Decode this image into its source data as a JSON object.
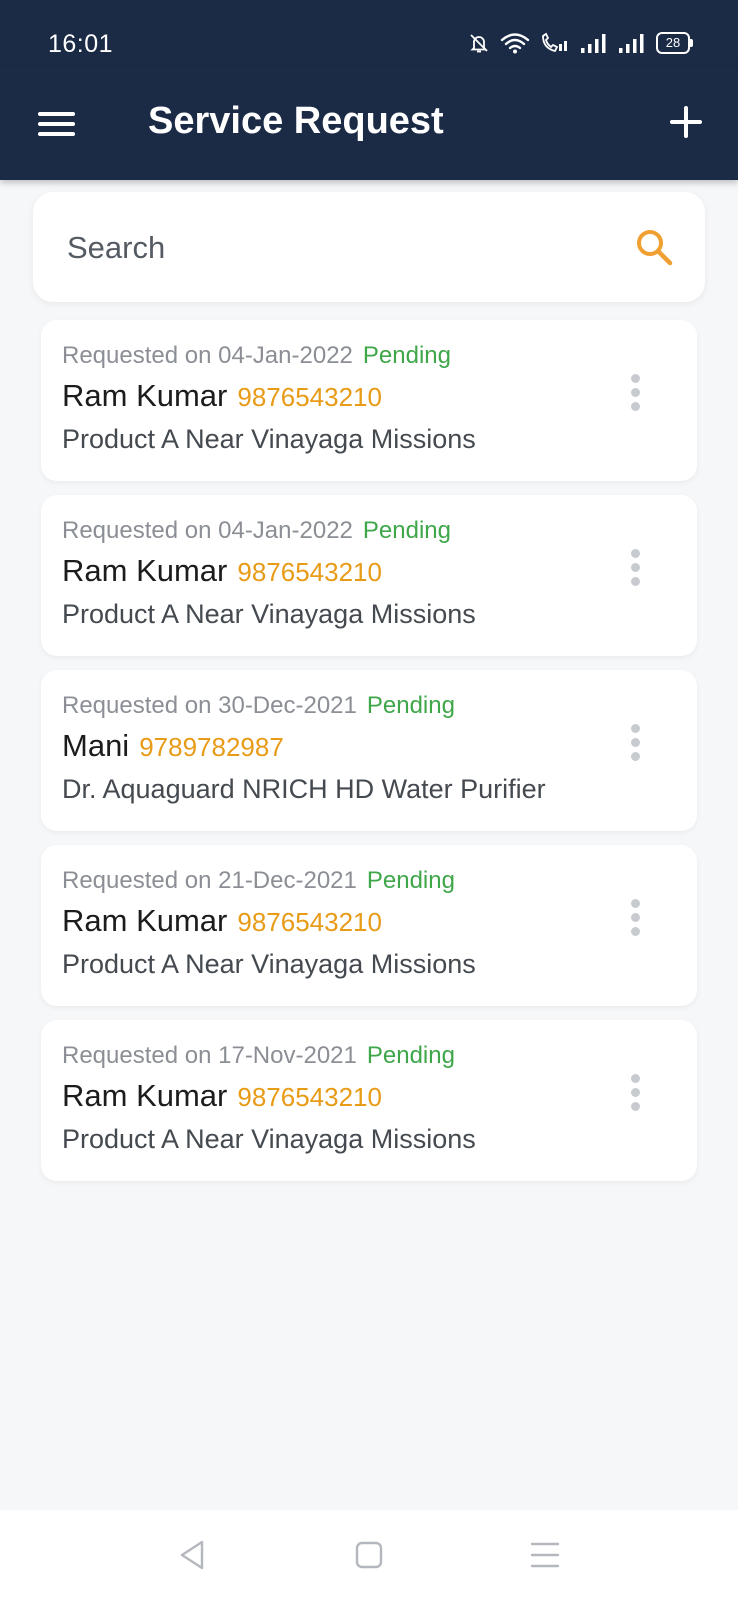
{
  "status_bar": {
    "time": "16:01",
    "battery": "28"
  },
  "app_bar": {
    "title": "Service Request"
  },
  "search": {
    "placeholder": "Search",
    "value": ""
  },
  "requests": [
    {
      "requested_label": "Requested on 04-Jan-2022",
      "status": "Pending",
      "name": "Ram Kumar",
      "phone": "9876543210",
      "description": "Product A Near Vinayaga Missions"
    },
    {
      "requested_label": "Requested on 04-Jan-2022",
      "status": "Pending",
      "name": "Ram Kumar",
      "phone": "9876543210",
      "description": "Product A Near Vinayaga Missions"
    },
    {
      "requested_label": "Requested on 30-Dec-2021",
      "status": "Pending",
      "name": "Mani",
      "phone": "9789782987",
      "description": "Dr. Aquaguard NRICH HD Water Purifier"
    },
    {
      "requested_label": "Requested on 21-Dec-2021",
      "status": "Pending",
      "name": "Ram Kumar",
      "phone": "9876543210",
      "description": "Product A Near Vinayaga Missions"
    },
    {
      "requested_label": "Requested on 17-Nov-2021",
      "status": "Pending",
      "name": "Ram Kumar",
      "phone": "9876543210",
      "description": "Product A Near Vinayaga Missions"
    }
  ],
  "icons": {
    "menu": "menu-icon",
    "add": "plus-icon",
    "search": "search-icon",
    "more": "more-vertical-icon",
    "nav_back": "back-triangle-icon",
    "nav_home": "home-square-icon",
    "nav_recents": "recents-menu-icon"
  },
  "colors": {
    "app_bar": "#1b2b46",
    "status_pending": "#3fa74a",
    "phone": "#e89b17",
    "search_icon": "#f0a030",
    "background": "#f6f7f9"
  }
}
